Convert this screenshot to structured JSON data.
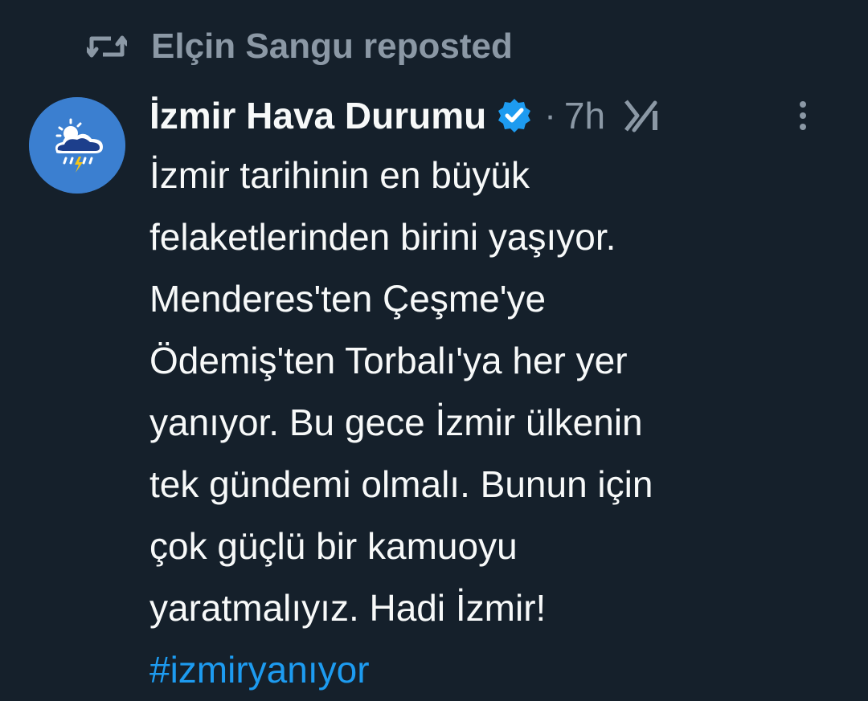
{
  "repost": {
    "icon": "repost-icon",
    "text": "Elçin Sangu reposted"
  },
  "tweet": {
    "avatar": "weather-cloud-avatar",
    "author_name": "İzmir Hava Durumu",
    "verified_icon": "verified-badge-icon",
    "separator": "·",
    "time": "7h",
    "grok_icon": "grok-icon",
    "more_icon": "more-options-icon",
    "lines": [
      "İzmir tarihinin en büyük",
      "felaketlerinden birini yaşıyor.",
      "Menderes'ten Çeşme'ye",
      "Ödemiş'ten Torbalı'ya her yer",
      "yanıyor. Bu gece İzmir ülkenin",
      "tek gündemi olmalı. Bunun için",
      "çok güçlü bir kamuoyu",
      "yaratmalıyız. Hadi İzmir!"
    ],
    "hashtag": "#izmiryanıyor"
  },
  "colors": {
    "background": "#15202b",
    "primary_text": "#f7f9f9",
    "secondary_text": "#8b98a5",
    "link": "#1d9bf0",
    "verified": "#1d9bf0",
    "avatar_bg": "#3b7fd0"
  }
}
